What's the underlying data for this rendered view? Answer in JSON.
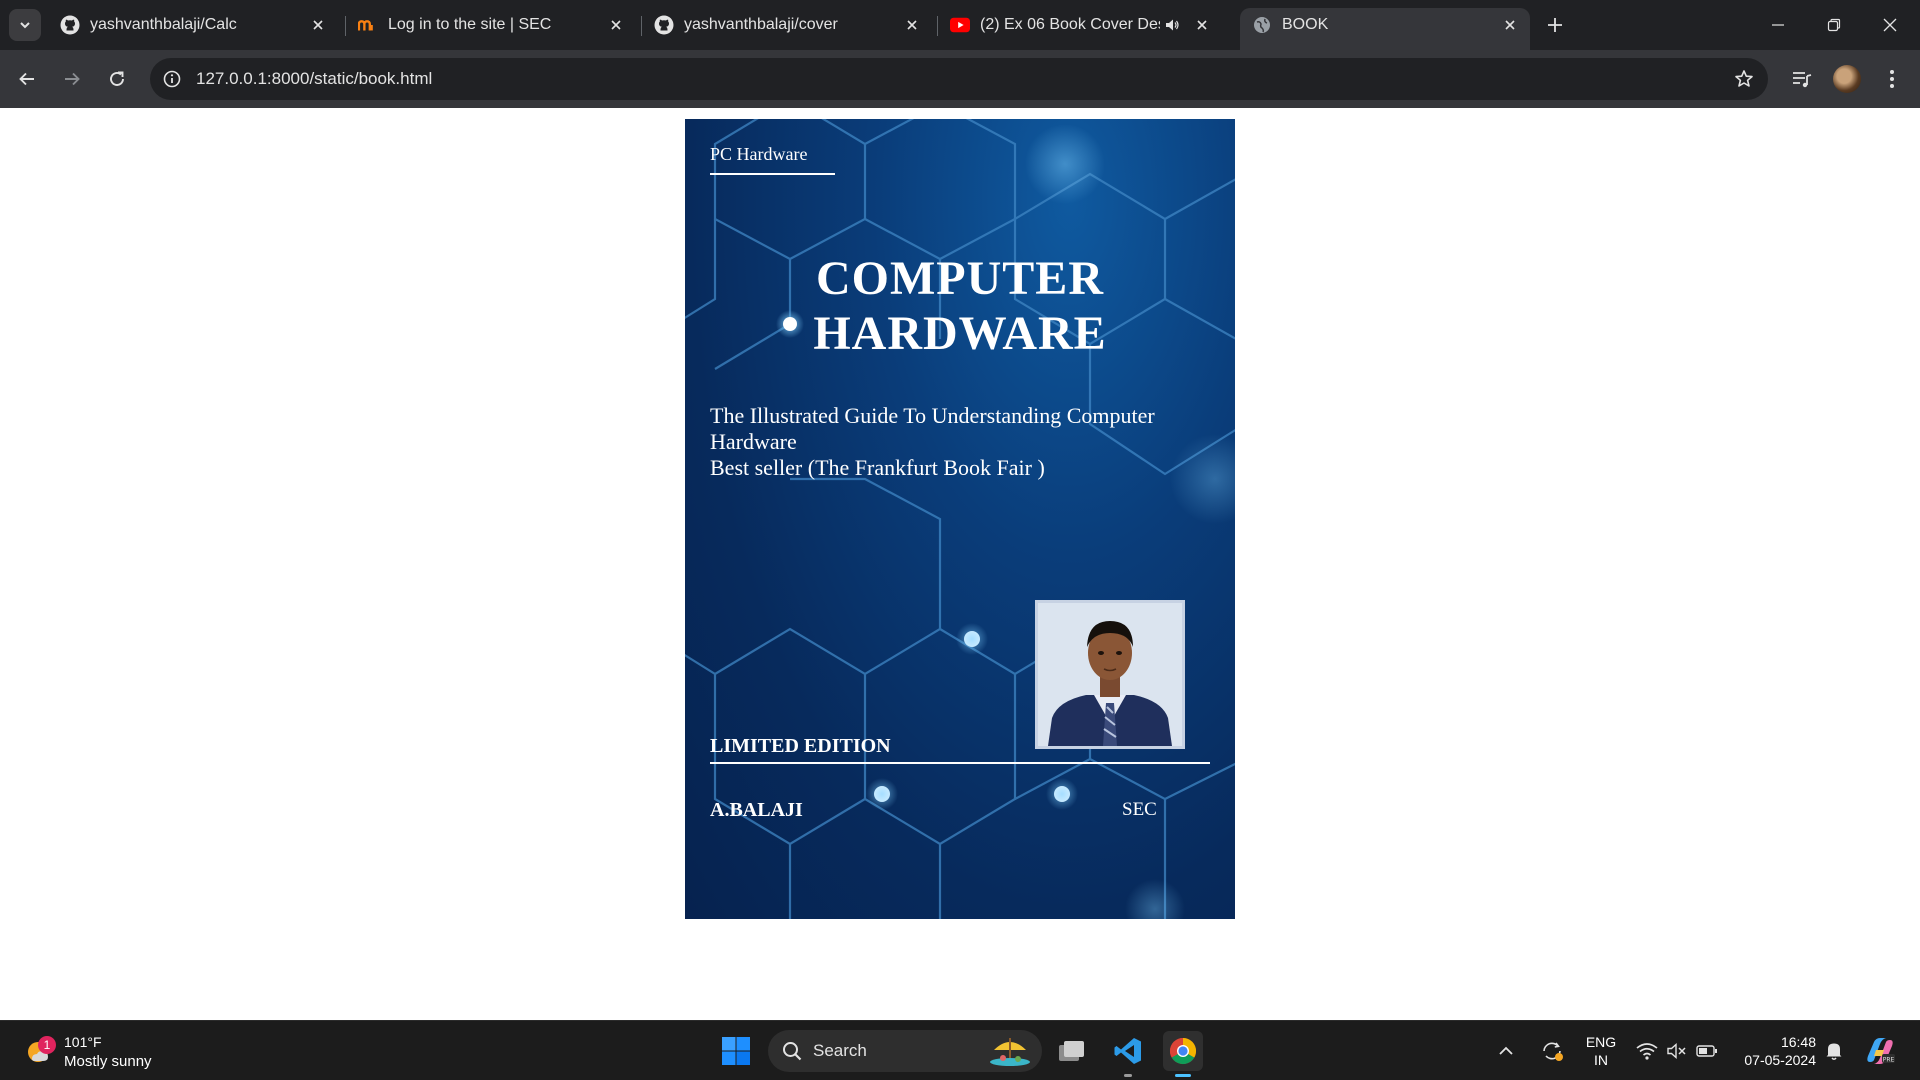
{
  "browser": {
    "tabs": [
      {
        "title": "yashvanthbalaji/Calc",
        "icon": "github-icon"
      },
      {
        "title": "Log in to the site | SEC",
        "icon": "moodle-icon"
      },
      {
        "title": "yashvanthbalaji/cover",
        "icon": "github-icon"
      },
      {
        "title": "(2) Ex 06 Book Cover Desig",
        "icon": "youtube-icon",
        "audio": true
      },
      {
        "title": "BOOK",
        "icon": "globe-icon",
        "active": true
      }
    ],
    "url": "127.0.0.1:8000/static/book.html"
  },
  "cover": {
    "series": "PC Hardware",
    "title_line1": "COMPUTER",
    "title_line2": "HARDWARE",
    "subtitle_line1": "The Illustrated Guide To Understanding Computer Hardware",
    "subtitle_line2": "Best seller (The Frankfurt Book Fair )",
    "edition": "LIMITED EDITION",
    "author": "A.BALAJI",
    "publisher": "SEC",
    "background_color": "#072a5c",
    "accent_color": "#5aa0d8"
  },
  "taskbar": {
    "weather_badge": "1",
    "weather_temp": "101°F",
    "weather_condition": "Mostly sunny",
    "search_label": "Search",
    "language_line1": "ENG",
    "language_line2": "IN",
    "time": "16:48",
    "date": "07-05-2024"
  }
}
